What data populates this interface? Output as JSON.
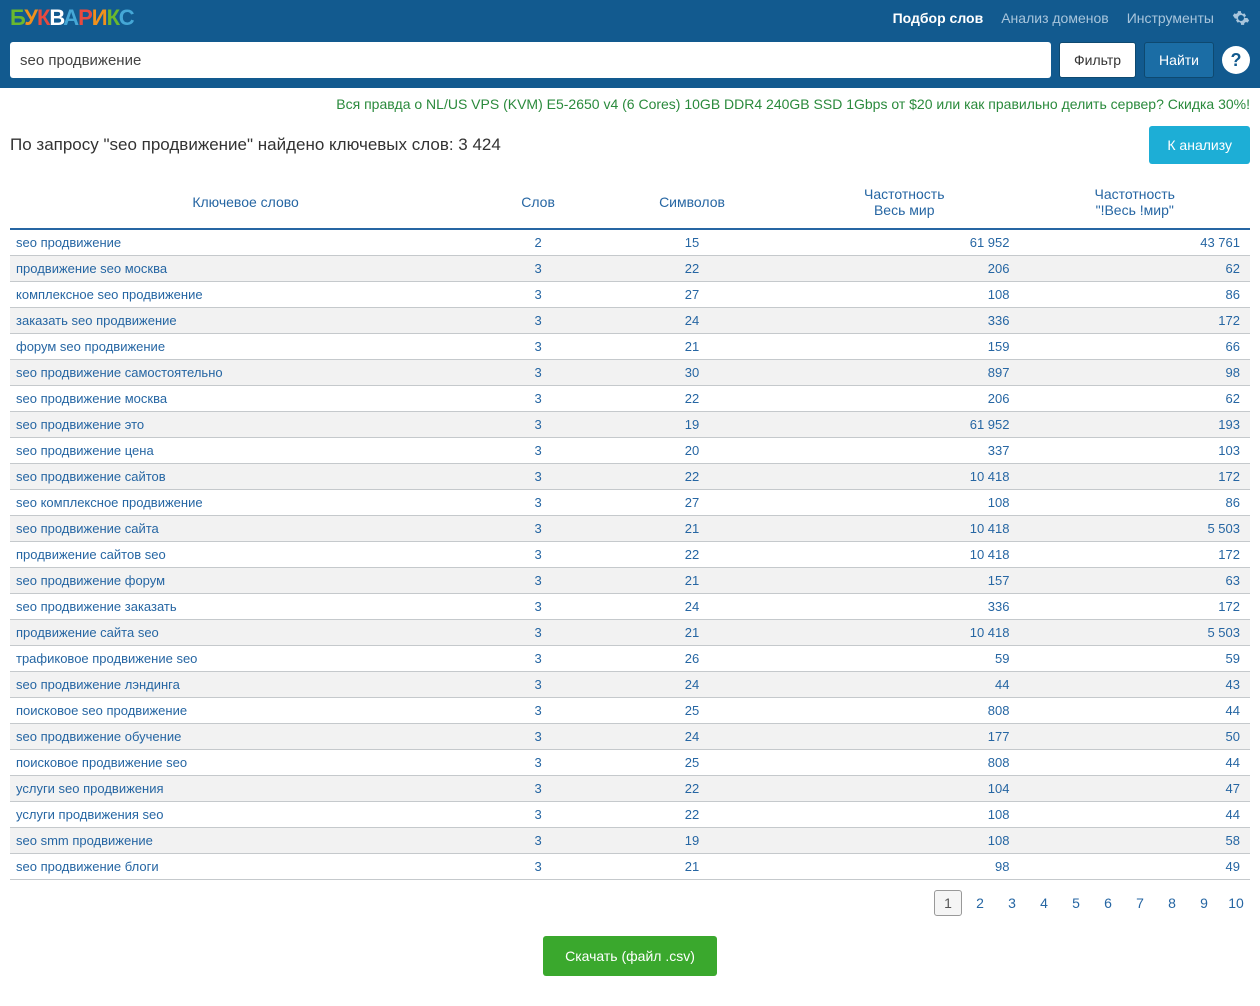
{
  "logo_letters": [
    "Б",
    "У",
    "К",
    "В",
    "А",
    "Р",
    "И",
    "К",
    "С"
  ],
  "nav": {
    "pick": "Подбор слов",
    "domains": "Анализ доменов",
    "tools": "Инструменты"
  },
  "search": {
    "value": "seo продвижение",
    "filter": "Фильтр",
    "find": "Найти",
    "help": "?"
  },
  "promo": "Вся правда о NL/US VPS (KVM) E5-2650 v4 (6 Cores) 10GB DDR4 240GB SSD 1Gbps от $20 или как правильно делить сервер? Скидка 30%!",
  "result_title": "По запросу \"seo продвижение\" найдено ключевых слов: 3 424",
  "to_analysis": "К анализу",
  "headers": {
    "kw": "Ключевое слово",
    "words": "Слов",
    "chars": "Символов",
    "freq1a": "Частотность",
    "freq1b": "Весь мир",
    "freq2a": "Частотность",
    "freq2b": "\"!Весь !мир\""
  },
  "rows": [
    {
      "kw": "seo продвижение",
      "w": "2",
      "c": "15",
      "f1": "61 952",
      "f2": "43 761"
    },
    {
      "kw": "продвижение seo москва",
      "w": "3",
      "c": "22",
      "f1": "206",
      "f2": "62"
    },
    {
      "kw": "комплексное seo продвижение",
      "w": "3",
      "c": "27",
      "f1": "108",
      "f2": "86"
    },
    {
      "kw": "заказать seo продвижение",
      "w": "3",
      "c": "24",
      "f1": "336",
      "f2": "172"
    },
    {
      "kw": "форум seo продвижение",
      "w": "3",
      "c": "21",
      "f1": "159",
      "f2": "66"
    },
    {
      "kw": "seo продвижение самостоятельно",
      "w": "3",
      "c": "30",
      "f1": "897",
      "f2": "98"
    },
    {
      "kw": "seo продвижение москва",
      "w": "3",
      "c": "22",
      "f1": "206",
      "f2": "62"
    },
    {
      "kw": "seo продвижение это",
      "w": "3",
      "c": "19",
      "f1": "61 952",
      "f2": "193"
    },
    {
      "kw": "seo продвижение цена",
      "w": "3",
      "c": "20",
      "f1": "337",
      "f2": "103"
    },
    {
      "kw": "seo продвижение сайтов",
      "w": "3",
      "c": "22",
      "f1": "10 418",
      "f2": "172"
    },
    {
      "kw": "seo комплексное продвижение",
      "w": "3",
      "c": "27",
      "f1": "108",
      "f2": "86"
    },
    {
      "kw": "seo продвижение сайта",
      "w": "3",
      "c": "21",
      "f1": "10 418",
      "f2": "5 503"
    },
    {
      "kw": "продвижение сайтов seo",
      "w": "3",
      "c": "22",
      "f1": "10 418",
      "f2": "172"
    },
    {
      "kw": "seo продвижение форум",
      "w": "3",
      "c": "21",
      "f1": "157",
      "f2": "63"
    },
    {
      "kw": "seo продвижение заказать",
      "w": "3",
      "c": "24",
      "f1": "336",
      "f2": "172"
    },
    {
      "kw": "продвижение сайта seo",
      "w": "3",
      "c": "21",
      "f1": "10 418",
      "f2": "5 503"
    },
    {
      "kw": "трафиковое продвижение seo",
      "w": "3",
      "c": "26",
      "f1": "59",
      "f2": "59"
    },
    {
      "kw": "seo продвижение лэндинга",
      "w": "3",
      "c": "24",
      "f1": "44",
      "f2": "43"
    },
    {
      "kw": "поисковое seo продвижение",
      "w": "3",
      "c": "25",
      "f1": "808",
      "f2": "44"
    },
    {
      "kw": "seo продвижение обучение",
      "w": "3",
      "c": "24",
      "f1": "177",
      "f2": "50"
    },
    {
      "kw": "поисковое продвижение seo",
      "w": "3",
      "c": "25",
      "f1": "808",
      "f2": "44"
    },
    {
      "kw": "услуги seo продвижения",
      "w": "3",
      "c": "22",
      "f1": "104",
      "f2": "47"
    },
    {
      "kw": "услуги продвижения seo",
      "w": "3",
      "c": "22",
      "f1": "108",
      "f2": "44"
    },
    {
      "kw": "seo smm продвижение",
      "w": "3",
      "c": "19",
      "f1": "108",
      "f2": "58"
    },
    {
      "kw": "seo продвижение блоги",
      "w": "3",
      "c": "21",
      "f1": "98",
      "f2": "49"
    }
  ],
  "pages": [
    "1",
    "2",
    "3",
    "4",
    "5",
    "6",
    "7",
    "8",
    "9",
    "10"
  ],
  "download": "Скачать (файл .csv)"
}
